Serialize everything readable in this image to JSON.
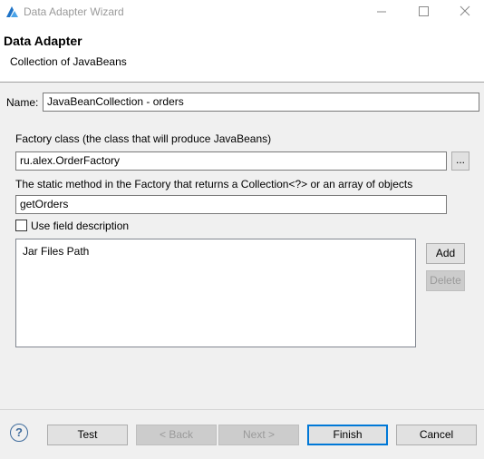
{
  "window": {
    "title": "Data Adapter Wizard",
    "minimize_glyph": "—",
    "maximize_glyph": "☐",
    "close_glyph": "✕"
  },
  "header": {
    "title": "Data Adapter",
    "subtitle": "Collection of JavaBeans"
  },
  "form": {
    "name_label": "Name:",
    "name_value": "JavaBeanCollection - orders",
    "factory_label": "Factory class (the class that will produce JavaBeans)",
    "factory_value": "ru.alex.OrderFactory",
    "browse_label": "...",
    "method_label": "The static method in the Factory that returns a Collection<?> or an array of objects",
    "method_value": "getOrders",
    "use_field_description_label": "Use field description",
    "use_field_description_checked": false
  },
  "jar_panel": {
    "items": [
      "Jar Files Path"
    ],
    "add_label": "Add",
    "delete_label": "Delete"
  },
  "footer": {
    "help_glyph": "?",
    "test_label": "Test",
    "back_label": "< Back",
    "next_label": "Next >",
    "finish_label": "Finish",
    "cancel_label": "Cancel"
  },
  "colors": {
    "accent": "#0078d7",
    "disabled_text": "#9a9a9a"
  }
}
